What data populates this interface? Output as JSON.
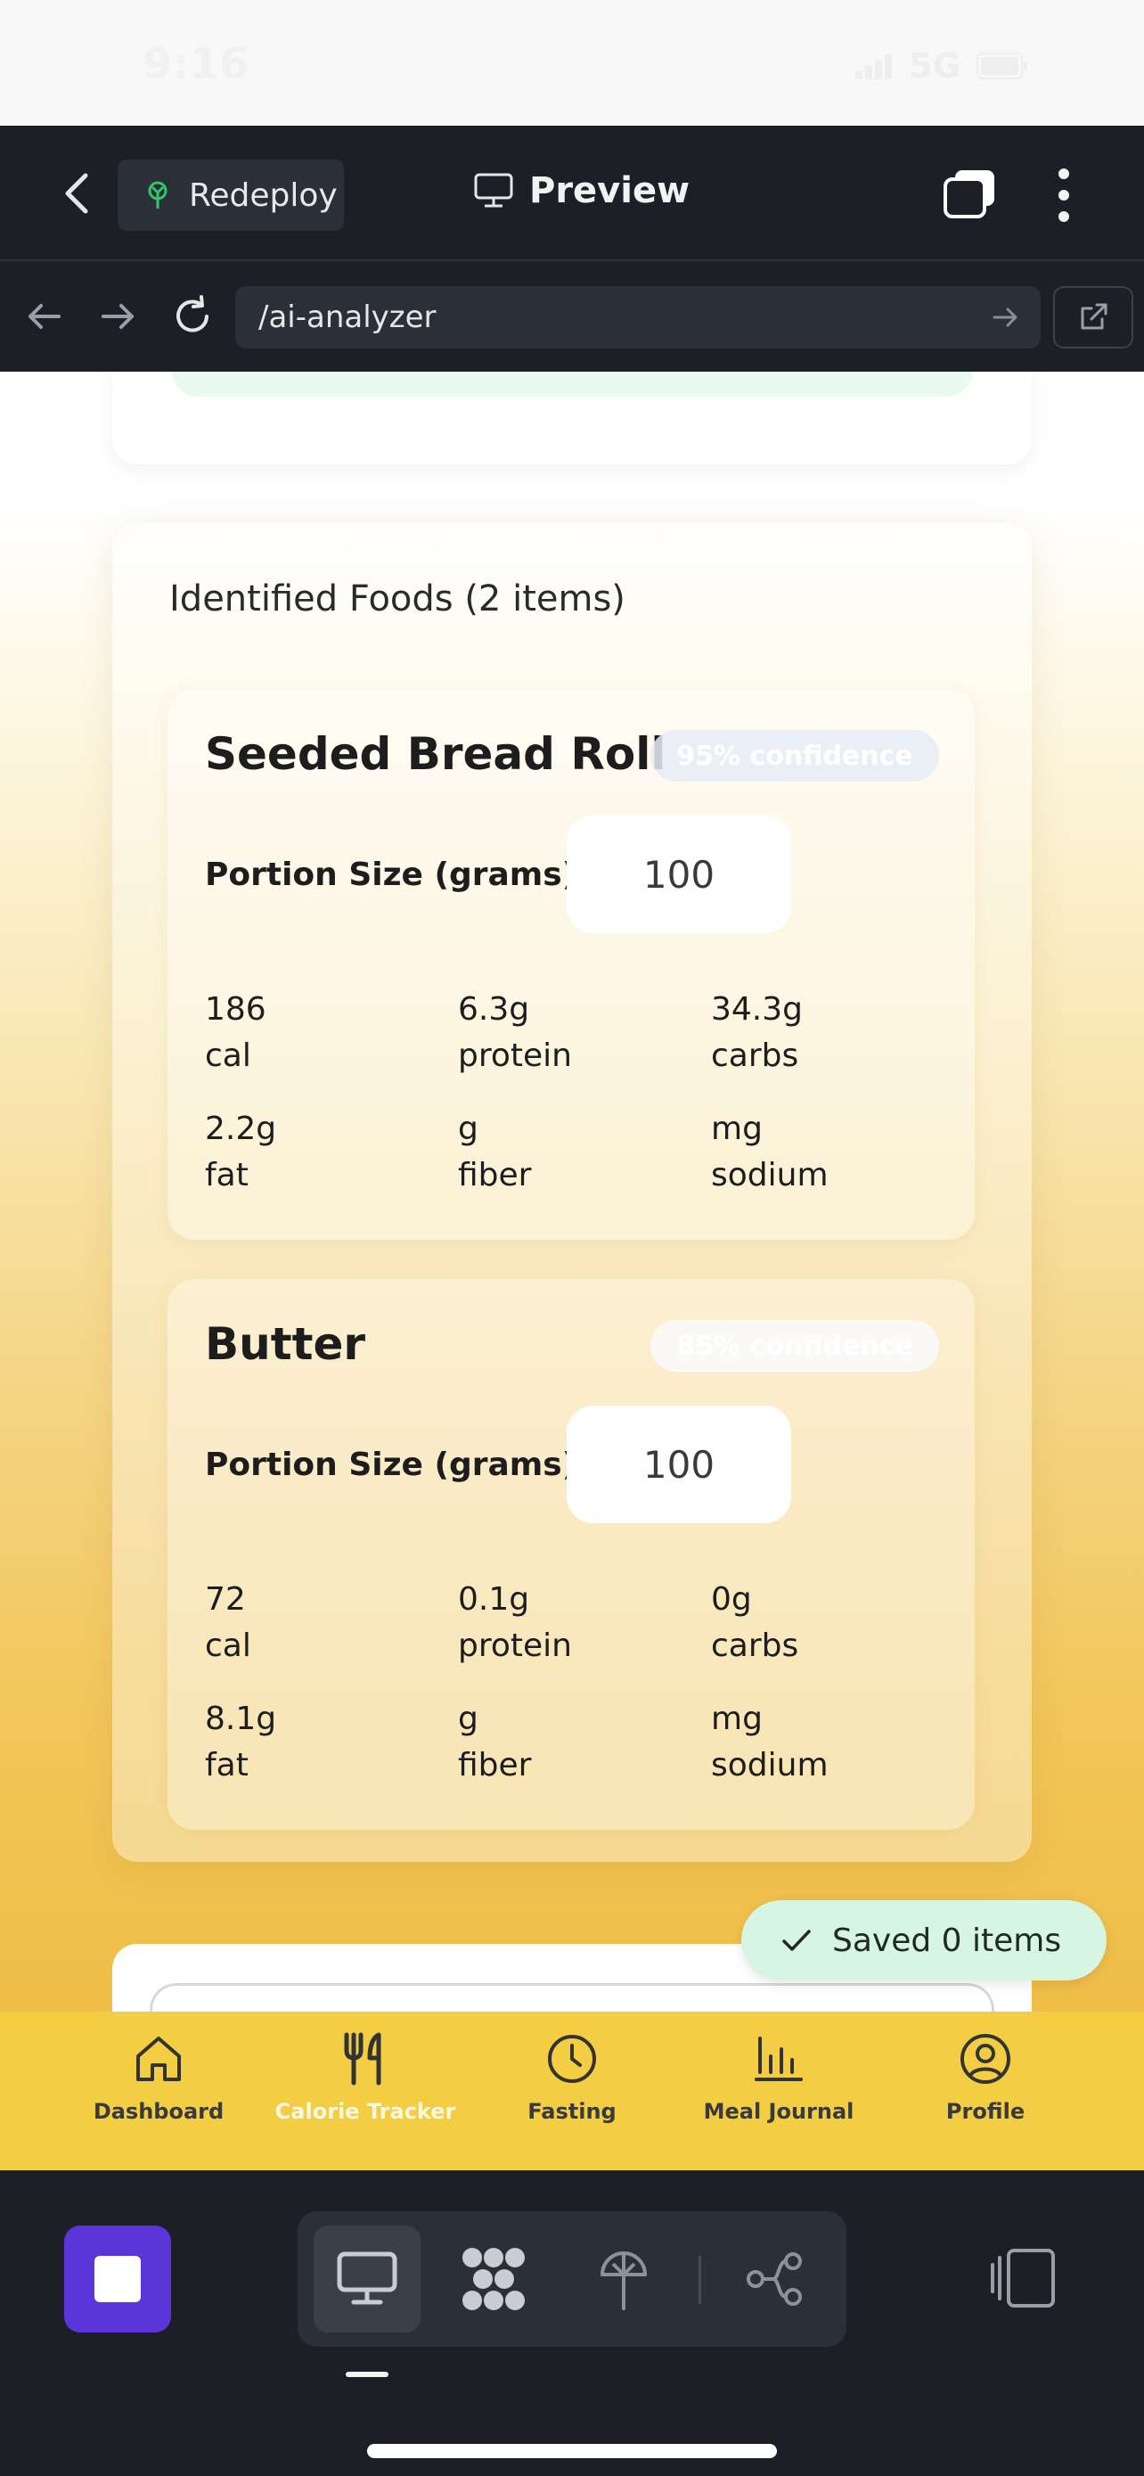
{
  "status_bar": {
    "time": "9:16",
    "network": "5G"
  },
  "top_bar": {
    "redeploy_label": "Redeploy",
    "preview_label": "Preview"
  },
  "url_bar": {
    "url": "/ai-analyzer"
  },
  "foods": {
    "title": "Identified Foods (2 items)",
    "portion_label": "Portion Size (grams):",
    "items": [
      {
        "name": "Seeded Bread Roll",
        "confidence": "95% confidence",
        "portion": "100",
        "nutrients": [
          {
            "value": "186",
            "unit": "cal"
          },
          {
            "value": "6.3g",
            "unit": "protein"
          },
          {
            "value": "34.3g",
            "unit": "carbs"
          },
          {
            "value": "2.2g",
            "unit": "fat"
          },
          {
            "value": "g",
            "unit": "fiber"
          },
          {
            "value": "mg",
            "unit": "sodium"
          }
        ]
      },
      {
        "name": "Butter",
        "confidence": "85% confidence",
        "portion": "100",
        "nutrients": [
          {
            "value": "72",
            "unit": "cal"
          },
          {
            "value": "0.1g",
            "unit": "protein"
          },
          {
            "value": "0g",
            "unit": "carbs"
          },
          {
            "value": "8.1g",
            "unit": "fat"
          },
          {
            "value": "g",
            "unit": "fiber"
          },
          {
            "value": "mg",
            "unit": "sodium"
          }
        ]
      }
    ]
  },
  "toast": {
    "text": "Saved 0 items"
  },
  "bottom_nav": {
    "items": [
      {
        "label": "Dashboard",
        "icon": "home-icon"
      },
      {
        "label": "Calorie Tracker",
        "icon": "utensils-icon",
        "active": true
      },
      {
        "label": "Fasting",
        "icon": "clock-icon"
      },
      {
        "label": "Meal Journal",
        "icon": "bar-chart-icon"
      },
      {
        "label": "Profile",
        "icon": "user-circle-icon"
      }
    ]
  },
  "colors": {
    "nav_bg": "#f3cd42",
    "stop_button": "#5b34da",
    "toast_bg": "#d6f5e2",
    "chrome_bg": "#1c1f26"
  }
}
